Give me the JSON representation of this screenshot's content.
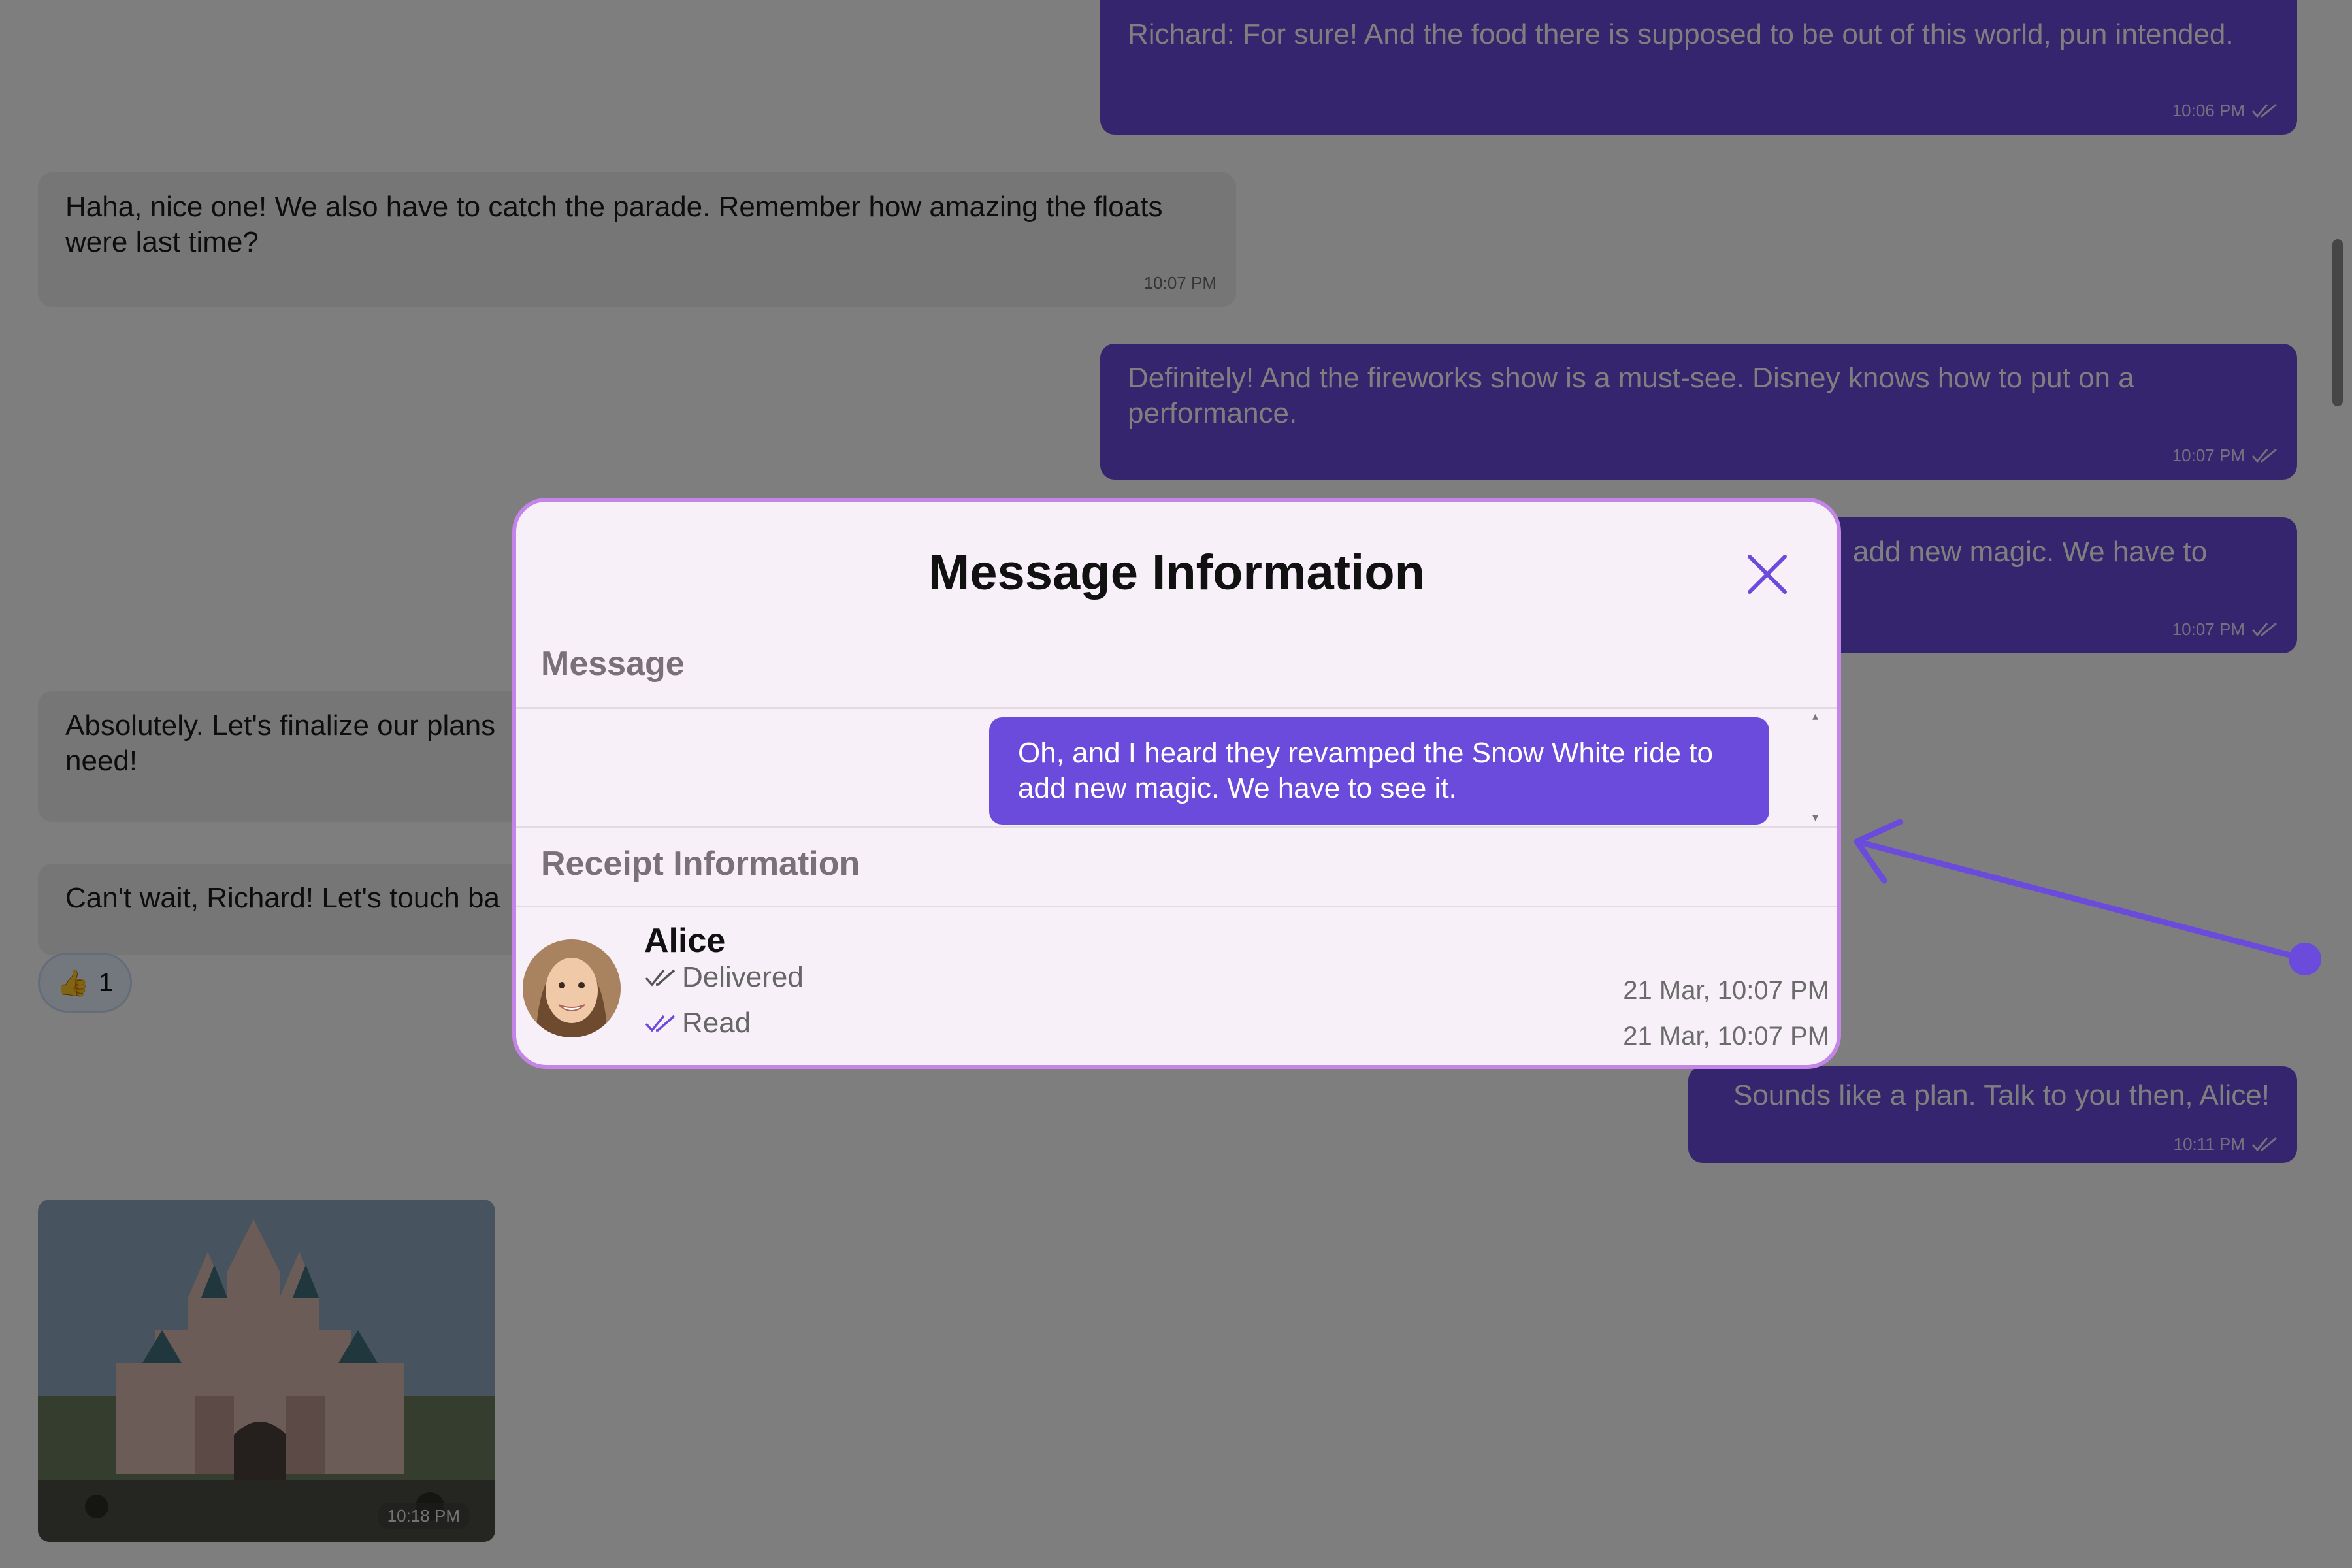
{
  "chat": {
    "messages": [
      {
        "text": "Richard: For sure! And the food there is supposed to be out of this world, pun intended.",
        "time": "10:06 PM"
      },
      {
        "text": "Haha, nice one! We also have to catch the parade. Remember how amazing the floats were last time?",
        "time": "10:07 PM"
      },
      {
        "text": "Definitely! And the fireworks show is a must-see. Disney knows how to put on a performance.",
        "time": "10:07 PM"
      },
      {
        "text": "add new magic. We have to",
        "time": "10:07 PM"
      },
      {
        "text": "Absolutely. Let's finalize our plans",
        "text2": "need!"
      },
      {
        "text": "Can't wait, Richard! Let's touch ba"
      },
      {
        "text": "Sounds like a plan. Talk to you then, Alice!",
        "time": "10:11 PM"
      }
    ],
    "reaction": {
      "emoji": "👍",
      "count": "1"
    },
    "photo": {
      "time": "10:18 PM"
    }
  },
  "modal": {
    "title": "Message Information",
    "message_section_label": "Message",
    "message_text": "Oh, and I heard they revamped the Snow White ride to add new magic. We have to see it.",
    "receipt_section_label": "Receipt Information",
    "receipt": {
      "name": "Alice",
      "delivered_label": "Delivered",
      "delivered_time": "21 Mar, 10:07 PM",
      "read_label": "Read",
      "read_time": "21 Mar, 10:07 PM"
    }
  },
  "colors": {
    "outgoing_bubble": "#6a4bdc",
    "modal_border": "#c584e8",
    "modal_background": "#f7f0f8",
    "read_tick": "#6a4bdc"
  },
  "icons": [
    "double-check-icon",
    "close-icon",
    "thumbs-up-icon",
    "arrow-pointer-icon"
  ]
}
